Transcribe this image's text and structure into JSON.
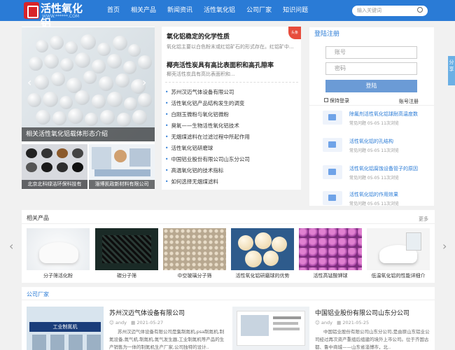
{
  "logo": {
    "text": "活性氧化铝",
    "sub": "WWW.******.COM"
  },
  "nav": {
    "items": [
      "首页",
      "相关产品",
      "新闻资讯",
      "活性氧化铝",
      "公司厂家",
      "知识问题"
    ]
  },
  "search": {
    "placeholder": "输入关键词"
  },
  "slider": {
    "caption": "相关活性氧化铝载体形态介绍",
    "prev": "‹",
    "next": "›"
  },
  "thumbs": [
    {
      "caption": "北京北科绿洁环保科技有"
    },
    {
      "caption": "淄博凯政新材料有限公司"
    }
  ],
  "news": {
    "ribbon": "头条",
    "headline1": {
      "title": "氧化铝稳定的化学性质",
      "desc": "氧化铝主要以白色粉末或红铝矿石的形式存在。红铝矿中..."
    },
    "headline2": {
      "title": "椰壳活性炭具有高比表面积和高孔隙率",
      "desc": "椰壳活性炭具有高比表面积和..."
    },
    "list": [
      "苏州汉迈气体设备有限公司",
      "活性氧化铝产品结构发生的调变",
      "白刚玉微粉与氧化铝微粉",
      "臭氧——生物活性氧化铝技术",
      "无烟煤滤料在过滤过程中所起作用",
      "活性氧化铝研磨球",
      "中国铝业股份有限公司山东分公司",
      "高温氧化铝的技术指标",
      "如何选择无烟煤滤料"
    ]
  },
  "login": {
    "title": "登陆注册",
    "account_placeholder": "账号",
    "password_placeholder": "密码",
    "submit": "登陆",
    "remember": "保持登录",
    "register": "账号注册"
  },
  "side_articles": [
    {
      "title": "除氟剂活性氧化铝球耐高温度数",
      "meta": "常见问题 05-05 11次浏览"
    },
    {
      "title": "活性氧化铝的孔结构",
      "meta": "常见问题 05-05 11次浏览"
    },
    {
      "title": "活性氧化铝腐蚀设备管子的原因",
      "meta": "常见问题 05-05 11次浏览"
    },
    {
      "title": "活性氧化铝的作用效果",
      "meta": "常见问题 05-05 11次浏览"
    }
  ],
  "products": {
    "title": "相关产品",
    "more": "更多",
    "prev": "‹",
    "next": "›",
    "items": [
      {
        "label": "分子筛活化粉"
      },
      {
        "label": "碳分子筛"
      },
      {
        "label": "中空玻璃分子筛"
      },
      {
        "label": "活性氧化铝研磨球的优势"
      },
      {
        "label": "活性高锰酸钾球"
      },
      {
        "label": "低温氧化铝的性能详细介"
      }
    ]
  },
  "companies": {
    "title": "公司厂家",
    "items": [
      {
        "name": "苏州汉迈气体设备有限公司",
        "author": "andy",
        "date": "2021-05-27",
        "text": "苏州汉迈气体设备有限公司是集制氮机,psa制氮机,制氮设备,氮气机,制氮机,氮气发生器,工业制氮机等产品的生产销售为一体的制氮机生产厂家,公司独特的设计..",
        "image_caption": "工业制氮机"
      },
      {
        "name": "中国铝业股份有限公司山东分公司",
        "author": "andy",
        "date": "2021-05-25",
        "text": "中国铝业股份有限公司山东分公司,是由原山东铝业公司经过再次资产重组后组建的境外上市公司。位于齐国古都、鲁中商城——山东省淄博市，北.."
      }
    ]
  },
  "side_tab": "分享",
  "colors": {
    "brand": "#2a7bd6",
    "accent": "#e74c3c"
  }
}
